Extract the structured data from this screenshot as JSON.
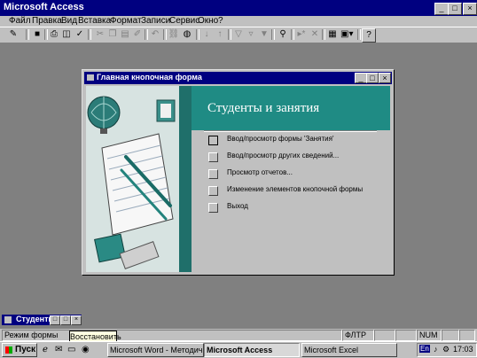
{
  "app": {
    "title": "Microsoft Access"
  },
  "window_buttons": {
    "minimize": "_",
    "maximize": "□",
    "close": "×"
  },
  "menu": {
    "items": [
      "Файл",
      "Правка",
      "Вид",
      "Вставка",
      "Формат",
      "Записи",
      "Сервис",
      "Окно",
      "?"
    ]
  },
  "toolbar": {
    "icons": [
      "design-view-icon",
      "save-icon",
      "print-icon",
      "print-preview-icon",
      "spelling-icon",
      "cut-icon",
      "copy-icon",
      "paste-icon",
      "format-painter-icon",
      "undo-icon",
      "insert-hyperlink-icon",
      "web-toolbar-icon",
      "sort-ascending-icon",
      "sort-descending-icon",
      "filter-by-selection-icon",
      "filter-by-form-icon",
      "apply-filter-icon",
      "find-icon",
      "new-record-icon",
      "delete-record-icon",
      "database-window-icon",
      "new-object-icon",
      "help-icon"
    ]
  },
  "switchboard": {
    "window_title": "Главная кнопочная форма",
    "heading": "Студенты и занятия",
    "items": [
      {
        "label": "Ввод/просмотр формы 'Занятия'"
      },
      {
        "label": "Ввод/просмотр других сведений..."
      },
      {
        "label": "Просмотр отчетов..."
      },
      {
        "label": "Изменение элементов кнопочной формы"
      },
      {
        "label": "Выход"
      }
    ]
  },
  "minimized_doc": {
    "title": "Студенты и"
  },
  "statusbar": {
    "mode": "Режим формы",
    "fltr": "ФЛТР",
    "num": "NUM"
  },
  "tooltip": {
    "text": "Восстановить"
  },
  "taskbar": {
    "start_label": "Пуск",
    "buttons": [
      {
        "label": "Microsoft Word - Методич...",
        "active": false
      },
      {
        "label": "Microsoft Access",
        "active": true
      },
      {
        "label": "Microsoft Excel",
        "active": false
      }
    ],
    "lang": "En",
    "clock": "17:03"
  },
  "colors": {
    "titlebar": "#000080",
    "desktop": "#808080",
    "switchboard_teal": "#1f8b84",
    "switchboard_stripe": "#1f6f6a"
  }
}
